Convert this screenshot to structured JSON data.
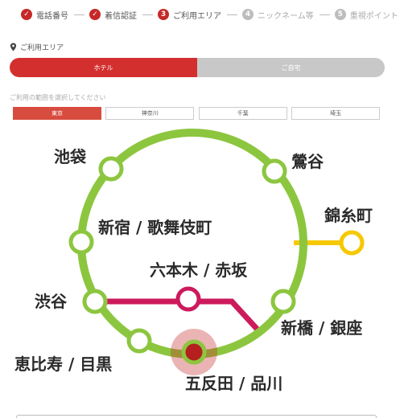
{
  "steps": [
    {
      "label": "電話番号",
      "state": "done"
    },
    {
      "label": "着信認証",
      "state": "done"
    },
    {
      "label": "ご利用エリア",
      "state": "current",
      "num": "3"
    },
    {
      "label": "ニックネーム等",
      "state": "todo",
      "num": "4"
    },
    {
      "label": "重視ポイント",
      "state": "todo",
      "num": "5"
    }
  ],
  "area": {
    "title": "ご利用エリア",
    "icon": "map-pin-icon"
  },
  "toggle": {
    "hotel": "ホテル",
    "home": "ご自宅",
    "selected": "ホテル"
  },
  "region_hint": "ご利用の範囲を選択してください",
  "regions": [
    {
      "label": "東京",
      "selected": true
    },
    {
      "label": "神奈川",
      "selected": false
    },
    {
      "label": "千葉",
      "selected": false
    },
    {
      "label": "埼玉",
      "selected": false
    }
  ],
  "map": {
    "stations": {
      "ikebukuro": "池袋",
      "uguisudani": "鶯谷",
      "kinshicho": "錦糸町",
      "shinjuku": "新宿 / 歌舞伎町",
      "roppongi": "六本木 / 赤坂",
      "shibuya": "渋谷",
      "shimbashi": "新橋 / 銀座",
      "ebisu": "恵比寿 / 目黒",
      "gotanda": "五反田 / 品川"
    },
    "selected_station": "五反田 / 品川"
  },
  "colors": {
    "accent": "#d32f2f",
    "loop_line": "#8cc63f",
    "branch_east": "#f6c800",
    "branch_center": "#cc1a5c",
    "inactive": "#c8c8c8"
  }
}
